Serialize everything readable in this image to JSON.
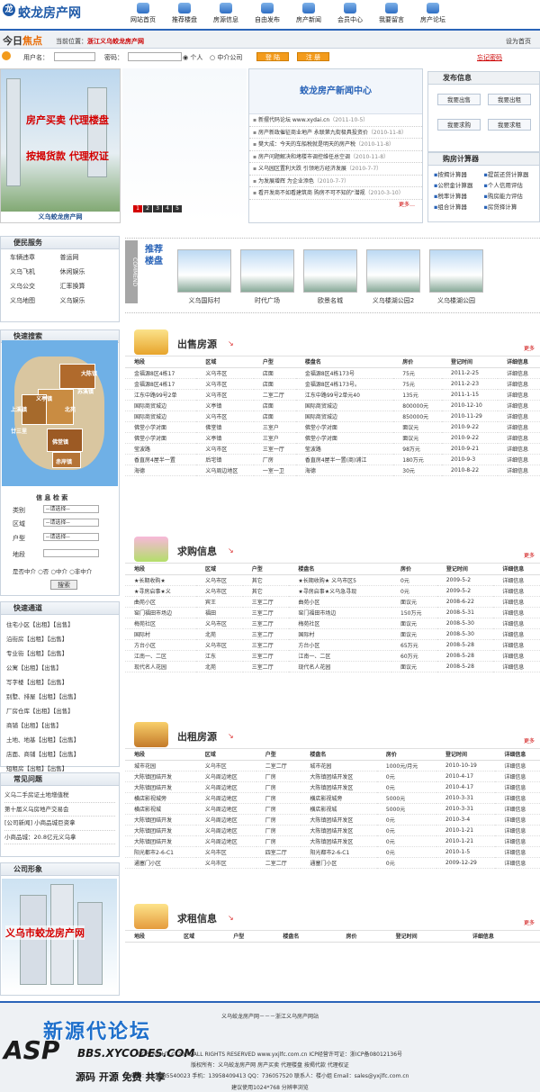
{
  "site": {
    "name": "蛟龙房产网"
  },
  "nav": [
    {
      "label": "网站首页"
    },
    {
      "label": "推荐楼盘"
    },
    {
      "label": "房源信息"
    },
    {
      "label": "自由发布"
    },
    {
      "label": "房产新闻"
    },
    {
      "label": "会员中心"
    },
    {
      "label": "我要留言"
    },
    {
      "label": "房产论坛"
    }
  ],
  "topbar": {
    "today": "今日",
    "focus": "焦点",
    "location_label": "当前位置：",
    "location": "浙江义乌蛟龙房产网",
    "sethome": "设为首页"
  },
  "login": {
    "user_label": "用户名：",
    "pass_label": "密码：",
    "radio1": "个人",
    "radio2": "中介公司",
    "login_btn": "登 陆",
    "register_btn": "注 册",
    "forgot": "忘记密码"
  },
  "banner": {
    "line1": "房产买卖  代理楼盘",
    "line2": "按揭货款  代理权证",
    "caption": "义乌蛟龙房产网",
    "pages": [
      "1",
      "2",
      "3",
      "4",
      "5"
    ]
  },
  "news": {
    "title": "蛟龙房产新闻中心",
    "items": [
      {
        "t": "新摆代码论坛 www.xydai.cn",
        "d": "（2011-10-5）"
      },
      {
        "t": "房产新政催征商业地产 永联第九街极具投资价",
        "d": "（2010-11-8）"
      },
      {
        "t": "樊大成：今天的车船税就是明天的房产税",
        "d": "（2010-11-8）"
      },
      {
        "t": "房产问题解决和堵楼市调控维任总空调",
        "d": "（2010-11-8）"
      },
      {
        "t": "义乌园区置利大跌 引领地方经济发展",
        "d": "（2010-7-7）"
      },
      {
        "t": "为发展增辉 为企业添色",
        "d": "（2010-7-7）"
      },
      {
        "t": "看开发商不如看建筑商 购房不可不知的\"潜规",
        "d": "（2010-3-10）"
      }
    ],
    "more": "更多…"
  },
  "publish": {
    "title": "发布信息",
    "buttons": [
      "我要出售",
      "我要出租",
      "我要求购",
      "我要求租"
    ]
  },
  "calc": {
    "title": "购房计算器",
    "items": [
      "按揭计算器",
      "提前还贷计算器",
      "公积金计算器",
      "个人信用评估",
      "税率计算器",
      "购房能力评估",
      "组合计算器",
      "房贷择计算"
    ]
  },
  "services": {
    "title": "便民服务",
    "items": [
      "车辆违章",
      "普运网",
      "义乌飞机",
      "休闲娱乐",
      "义乌公交",
      "汇率换算",
      "义乌地图",
      "义乌娱乐"
    ]
  },
  "quicksearch": {
    "title": "快速搜索",
    "map_labels": [
      "大陈镇",
      "苏溪镇",
      "义亭镇",
      "上溪镇",
      "佛堂镇",
      "赤岸镇",
      "北苑",
      "廿三里"
    ],
    "search_title": "信 息 检 索",
    "type_label": "类别",
    "area_label": "区域",
    "house_label": "户型",
    "road_label": "地段",
    "select_text": "--请选择--",
    "from_label": "是否中介",
    "opt1": "否",
    "opt2": "中介",
    "opt3": "非中介",
    "btn": "搜索"
  },
  "quick": {
    "title": "快速通道",
    "items": [
      "住宅小区【出租】【出售】",
      "沿街房【出租】【出售】",
      "专业街【出租】【出售】",
      "公寓【出租】【出售】",
      "写字楼【出租】【出售】",
      "别墅、排屋【出租】【出售】",
      "厂房仓库【出租】【出售】",
      "商铺【出租】【出售】",
      "土地、地基【出租】【出售】",
      "店面、商铺【出租】【出售】",
      "短租房【出租】【出售】"
    ]
  },
  "faq": {
    "title": "常见问题",
    "items": [
      "义乌二手房证土地增值税",
      "第十届义乌房地产交易会",
      "[公司新闻] 小商品城巨资拿",
      "小商品城：20.8亿元义乌拿"
    ]
  },
  "company": {
    "title": "公司形象",
    "caption": "义乌市蛟龙房产网"
  },
  "recommend": {
    "side": "COMMEND",
    "title": "推荐楼盘",
    "items": [
      "义乌国际村",
      "时代广场",
      "欧景名城",
      "义乌楼湖公园2",
      "义乌楼湖公园"
    ]
  },
  "sale": {
    "title": "出售房源",
    "more": "更多",
    "cols": [
      "地段",
      "区域",
      "户型",
      "楼盘名",
      "房价",
      "登记时间",
      "详细信息"
    ],
    "rows": [
      [
        "金福源8区4栋17",
        "义乌市区",
        "店面",
        "金福源8区4栋173号",
        "75元",
        "2011-2-25",
        "详细信息"
      ],
      [
        "金福源8区4栋17",
        "义乌市区",
        "店面",
        "金福源8区4栋173号。",
        "75元",
        "2011-2-23",
        "详细信息"
      ],
      [
        "江东中路99号2单",
        "义乌市区",
        "二室二厅",
        "江东中路99号2单元40",
        "135元",
        "2011-1-15",
        "详细信息"
      ],
      [
        "国际商贸城边",
        "义亭镇",
        "店面",
        "国际商贸城边",
        "800000元",
        "2010-12-10",
        "详细信息"
      ],
      [
        "国际商贸城边",
        "义乌市区",
        "店面",
        "国际商贸城边",
        "850000元",
        "2010-11-29",
        "详细信息"
      ],
      [
        "佛堂小学对面",
        "佛堂镇",
        "三室户",
        "佛堂小学对面",
        "面议元",
        "2010-9-22",
        "详细信息"
      ],
      [
        "佛堂小学对面",
        "义亭镇",
        "三室户",
        "佛堂小学对面",
        "面议元",
        "2010-9-22",
        "详细信息"
      ],
      [
        "莹波路",
        "义乌市区",
        "三室一厅",
        "莹波路",
        "98万元",
        "2010-9-21",
        "详细信息"
      ],
      [
        "香直房4屋半一置",
        "后宅镇",
        "厂房",
        "香直房4屋半一置(商)浦江",
        "180万元",
        "2010-9-3",
        "详细信息"
      ],
      [
        "海德",
        "义乌周边地区",
        "一室一卫",
        "海德",
        "30元",
        "2010-8-22",
        "详细信息"
      ]
    ]
  },
  "buy": {
    "title": "求购信息",
    "more": "更多",
    "cols": [
      "地段",
      "区域",
      "户型",
      "楼盘名",
      "房价",
      "登记时间",
      "详细信息"
    ],
    "rows": [
      [
        "★长期收购★",
        "义乌市区",
        "其它",
        "★长期收购★ 义乌市区5",
        "0元",
        "2009-5-2",
        "详细信息"
      ],
      [
        "★寻房启事★义",
        "义乌市区",
        "其它",
        "★寻房启事★义乌急寻现",
        "0元",
        "2009-5-2",
        "详细信息"
      ],
      [
        "曲苑小区",
        "宾王",
        "三室二厅",
        "曲苑小区",
        "面议元",
        "2008-6-22",
        "详细信息"
      ],
      [
        "窑门福田市场边",
        "福田",
        "三室二厅",
        "窑门福田市场边",
        "150万元",
        "2008-5-31",
        "详细信息"
      ],
      [
        "梅苑社区",
        "义乌市区",
        "三室二厅",
        "梅苑社区",
        "面议元",
        "2008-5-30",
        "详细信息"
      ],
      [
        "国际村",
        "北苑",
        "三室二厅",
        "国际村",
        "面议元",
        "2008-5-30",
        "详细信息"
      ],
      [
        "方台小区",
        "义乌市区",
        "三室二厅",
        "方台小区",
        "65万元",
        "2008-5-28",
        "详细信息"
      ],
      [
        "江南一、二区",
        "江东",
        "三室二厅",
        "江南一、二区",
        "60万元",
        "2008-5-28",
        "详细信息"
      ],
      [
        "现代名人花园",
        "北苑",
        "三室二厅",
        "现代名人花园",
        "面议元",
        "2008-5-28",
        "详细信息"
      ]
    ]
  },
  "rent": {
    "title": "出租房源",
    "more": "更多",
    "cols": [
      "地段",
      "区域",
      "户型",
      "楼盘名",
      "房价",
      "登记时间",
      "详细信息"
    ],
    "rows": [
      [
        "城市花园",
        "义乌市区",
        "二室二厅",
        "城市花园",
        "1000元/月元",
        "2010-10-19",
        "详细信息"
      ],
      [
        "大陈镇团结开发",
        "义乌周边地区",
        "厂房",
        "大陈镇团结开发区",
        "0元",
        "2010-4-17",
        "详细信息"
      ],
      [
        "大陈镇团结开发",
        "义乌周边地区",
        "厂房",
        "大陈镇团结开发区",
        "0元",
        "2010-4-17",
        "详细信息"
      ],
      [
        "横店影视城旁",
        "义乌周边地区",
        "厂房",
        "横店影视城旁",
        "5000元",
        "2010-3-31",
        "详细信息"
      ],
      [
        "横店影视城",
        "义乌周边地区",
        "厂房",
        "横店影视城",
        "5000元",
        "2010-3-31",
        "详细信息"
      ],
      [
        "大陈镇团结开发",
        "义乌周边地区",
        "厂房",
        "大陈镇团结开发区",
        "0元",
        "2010-3-4",
        "详细信息"
      ],
      [
        "大陈镇团结开发",
        "义乌周边地区",
        "厂房",
        "大陈镇团结开发区",
        "0元",
        "2010-1-21",
        "详细信息"
      ],
      [
        "大陈镇团结开发",
        "义乌周边地区",
        "厂房",
        "大陈镇团结开发区",
        "0元",
        "2010-1-21",
        "详细信息"
      ],
      [
        "阳光都市2-6-C1",
        "义乌市区",
        "四室二厅",
        "阳光都市2-6-C1",
        "0元",
        "2010-1-5",
        "详细信息"
      ],
      [
        "通塞门小区",
        "义乌市区",
        "二室二厅",
        "通塞门小区",
        "0元",
        "2009-12-29",
        "详细信息"
      ]
    ]
  },
  "want": {
    "title": "求租信息",
    "more": "更多",
    "cols": [
      "地段",
      "区域",
      "户型",
      "楼盘名",
      "房价",
      "登记时间",
      "详细信息"
    ]
  },
  "footer": {
    "lines": [
      "义乌蛟龙房产网－－－浙江义乌房产网站",
      "COPYRIGHT © 2008 ALL RIGHTS RESERVED www.yxjlfc.com.cn ICP经营许可证：浙ICP备08012136号",
      "版权所有：义乌蛟龙房产网 房产买卖 代理楼盘 按揭代款 代理权证",
      "电话：0579-85540023 手机：13958409413 QQ：736057520 联系人：楼小姐 Email：sales@yxjlfc.com.cn",
      "建议使用1024*768 分辨率浏览"
    ],
    "watermark": "新源代论坛",
    "watermark2": "BBS.XYCODES.COM",
    "watermark3": "源码 开源 免费 共享",
    "asp": "ASP"
  },
  "colors": {
    "accent": "#2a64b8",
    "orange": "#f39b1c",
    "red": "#c00"
  }
}
